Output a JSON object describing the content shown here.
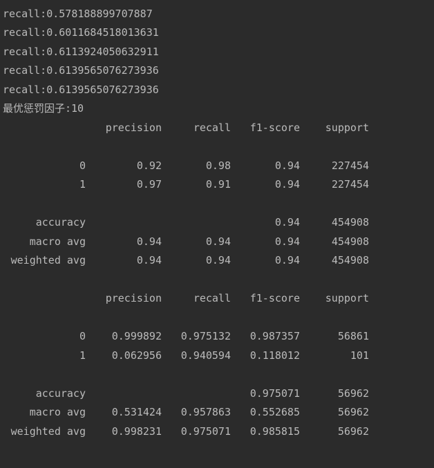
{
  "console": {
    "partial_top_line": "                               _        _",
    "recall_lines": [
      "recall:0.578188899707887",
      "recall:0.6011684518013631",
      "recall:0.6113924050632911",
      "recall:0.6139565076273936",
      "recall:0.6139565076273936"
    ],
    "best_factor_line": "最优惩罚因子:10",
    "report1": {
      "headers": [
        "precision",
        "recall",
        "f1-score",
        "support"
      ],
      "rows": [
        [
          "0",
          "0.92",
          "0.98",
          "0.94",
          "227454"
        ],
        [
          "1",
          "0.97",
          "0.91",
          "0.94",
          "227454"
        ]
      ],
      "summary": [
        [
          "accuracy",
          "",
          "",
          "0.94",
          "454908"
        ],
        [
          "macro avg",
          "0.94",
          "0.94",
          "0.94",
          "454908"
        ],
        [
          "weighted avg",
          "0.94",
          "0.94",
          "0.94",
          "454908"
        ]
      ]
    },
    "report2": {
      "headers": [
        "precision",
        "recall",
        "f1-score",
        "support"
      ],
      "rows": [
        [
          "0",
          "0.999892",
          "0.975132",
          "0.987357",
          "56861"
        ],
        [
          "1",
          "0.062956",
          "0.940594",
          "0.118012",
          "101"
        ]
      ],
      "summary": [
        [
          "accuracy",
          "",
          "",
          "0.975071",
          "56962"
        ],
        [
          "macro avg",
          "0.531424",
          "0.957863",
          "0.552685",
          "56962"
        ],
        [
          "weighted avg",
          "0.998231",
          "0.975071",
          "0.985815",
          "56962"
        ]
      ]
    }
  }
}
